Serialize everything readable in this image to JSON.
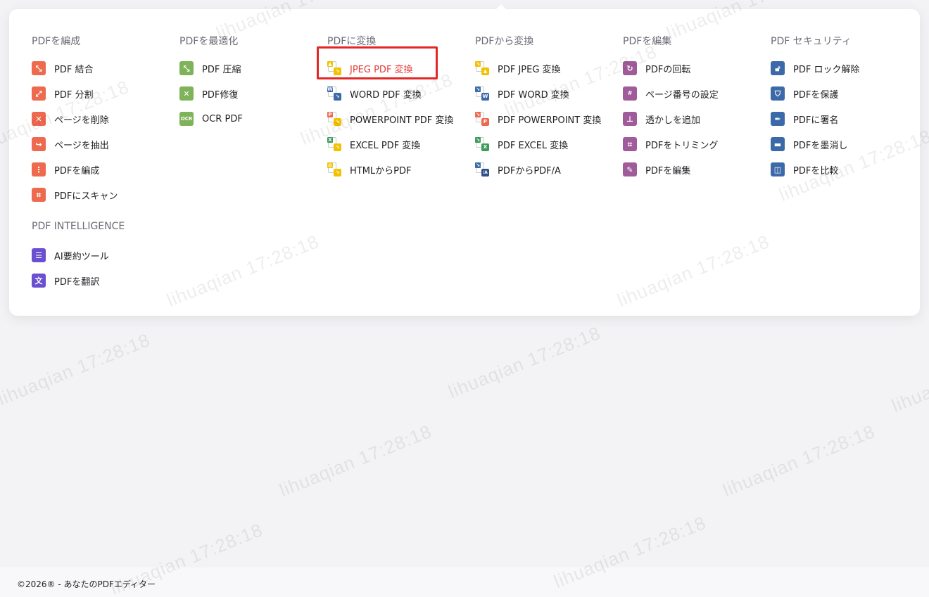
{
  "columns": [
    {
      "title": "PDFを編成",
      "items": [
        {
          "label": "PDF 結合",
          "icon": "merge-icon",
          "color": "#ee6a4f"
        },
        {
          "label": "PDF 分割",
          "icon": "split-icon",
          "color": "#ee6a4f"
        },
        {
          "label": "ページを削除",
          "icon": "delete-page-icon",
          "color": "#ee6a4f"
        },
        {
          "label": "ページを抽出",
          "icon": "extract-page-icon",
          "color": "#ee6a4f"
        },
        {
          "label": "PDFを編成",
          "icon": "organize-icon",
          "color": "#ee6a4f"
        },
        {
          "label": "PDFにスキャン",
          "icon": "scan-icon",
          "color": "#ee6a4f"
        }
      ]
    },
    {
      "title": "PDFを最適化",
      "items": [
        {
          "label": "PDF 圧縮",
          "icon": "compress-icon",
          "color": "#7fb35a"
        },
        {
          "label": "PDF修復",
          "icon": "repair-icon",
          "color": "#7fb35a"
        },
        {
          "label": "OCR PDF",
          "icon": "ocr-icon",
          "color": "#7fb35a"
        }
      ]
    },
    {
      "title": "PDFに変換",
      "items": [
        {
          "label": "JPEG PDF 変換",
          "icon": "jpeg-to-pdf-icon",
          "active": true
        },
        {
          "label": "WORD PDF 変換",
          "icon": "word-to-pdf-icon"
        },
        {
          "label": "POWERPOINT PDF 変換",
          "icon": "powerpoint-to-pdf-icon"
        },
        {
          "label": "EXCEL PDF 変換",
          "icon": "excel-to-pdf-icon"
        },
        {
          "label": "HTMLからPDF",
          "icon": "html-to-pdf-icon"
        }
      ]
    },
    {
      "title": "PDFから変換",
      "items": [
        {
          "label": "PDF JPEG 変換",
          "icon": "pdf-to-jpeg-icon"
        },
        {
          "label": "PDF WORD 変換",
          "icon": "pdf-to-word-icon"
        },
        {
          "label": "PDF POWERPOINT 変換",
          "icon": "pdf-to-powerpoint-icon"
        },
        {
          "label": "PDF EXCEL 変換",
          "icon": "pdf-to-excel-icon"
        },
        {
          "label": "PDFからPDF/A",
          "icon": "pdf-to-pdfa-icon"
        }
      ]
    },
    {
      "title": "PDFを編集",
      "items": [
        {
          "label": "PDFの回転",
          "icon": "rotate-icon",
          "color": "#a05c9a"
        },
        {
          "label": "ページ番号の設定",
          "icon": "page-number-icon",
          "color": "#a05c9a"
        },
        {
          "label": "透かしを追加",
          "icon": "watermark-stamp-icon",
          "color": "#a05c9a"
        },
        {
          "label": "PDFをトリミング",
          "icon": "crop-icon",
          "color": "#a05c9a"
        },
        {
          "label": "PDFを編集",
          "icon": "pencil-icon",
          "color": "#a05c9a"
        }
      ]
    },
    {
      "title": "PDF セキュリティ",
      "items": [
        {
          "label": "PDF ロック解除",
          "icon": "unlock-icon",
          "color": "#3c6aa8"
        },
        {
          "label": "PDFを保護",
          "icon": "shield-icon",
          "color": "#3c6aa8"
        },
        {
          "label": "PDFに署名",
          "icon": "sign-icon",
          "color": "#3c6aa8"
        },
        {
          "label": "PDFを墨消し",
          "icon": "redact-icon",
          "color": "#3c6aa8"
        },
        {
          "label": "PDFを比較",
          "icon": "compare-icon",
          "color": "#3c6aa8"
        }
      ]
    }
  ],
  "intelligence": {
    "title": "PDF INTELLIGENCE",
    "items": [
      {
        "label": "AI要約ツール",
        "icon": "ai-summary-icon",
        "color": "#6a4fcf"
      },
      {
        "label": "PDFを翻訳",
        "icon": "translate-icon",
        "color": "#6a4fcf"
      }
    ]
  },
  "active_color": "#e53935",
  "watermark_text": "lihuaqian  17:28:18",
  "footer": {
    "copyright": "©2026® - あなたのPDFエディター"
  }
}
